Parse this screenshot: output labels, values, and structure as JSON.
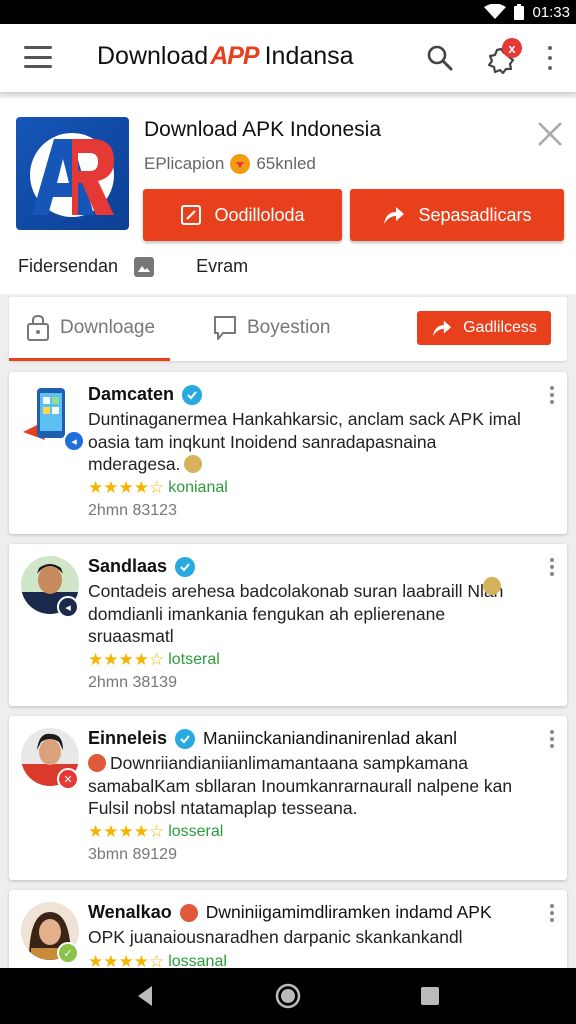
{
  "status_bar": {
    "time": "01:33",
    "icons": [
      "wifi-icon",
      "battery-icon"
    ]
  },
  "app_bar": {
    "title_left": "Download",
    "title_logo": "APP",
    "title_right": "Indansa",
    "gear_badge": "x"
  },
  "app_header": {
    "title": "Download APK Indonesia",
    "category": "EPlicapion",
    "installs": "65knled",
    "primary_button": "Oodilloloda",
    "secondary_button": "Sepasadlicars",
    "sub_left": "Fidersendan",
    "sub_right": "Evram"
  },
  "tabs": [
    {
      "label": "Downloage",
      "icon": "lock-icon",
      "active": true
    },
    {
      "label": "Boyestion",
      "icon": "comment-icon",
      "active": false
    }
  ],
  "tab_action": "Gadlilcess",
  "reviews": [
    {
      "name": "Damcaten",
      "text": "Duntinaganermea Hankahkarsic, anclam sack APK imal oasia tam inqkunt Inoidend sanradapasnaina mderagesa.",
      "rating_label": "konianal",
      "stars": "★★★★☆",
      "date": "2hmn 83123"
    },
    {
      "name": "Sandlaas",
      "text": "Contadeis arehesa badcolakonab suran laabraill Nlan domdianli imankania fengukan ah eplierenane sruaasmatl",
      "rating_label": "lotseral",
      "stars": "★★★★☆",
      "date": "2hmn 38139"
    },
    {
      "name": "Einneleis",
      "headline": "Maniinckaniandinanirenlad akanl",
      "text": "Downriiandianiianlimamantaana sampkamana samabalKam sbllaran Inoumkanrarnaurall nalpene kan Fulsil nobsl ntatamaplap tesseana.",
      "rating_label": "losseral",
      "stars": "★★★★☆",
      "date": "3bmn 89129"
    },
    {
      "name": "Wenalkao",
      "headline": "Dwniniigamimdliramken indamd APK",
      "text": "OPK juanaiousnaradhen darpanic skankankandl",
      "rating_label": "lossanal",
      "stars": "★★★★☆"
    }
  ],
  "colors": {
    "accent": "#e8401c",
    "verified": "#29a9e0",
    "rating_text": "#2a9d3a",
    "star": "#f5b400"
  }
}
